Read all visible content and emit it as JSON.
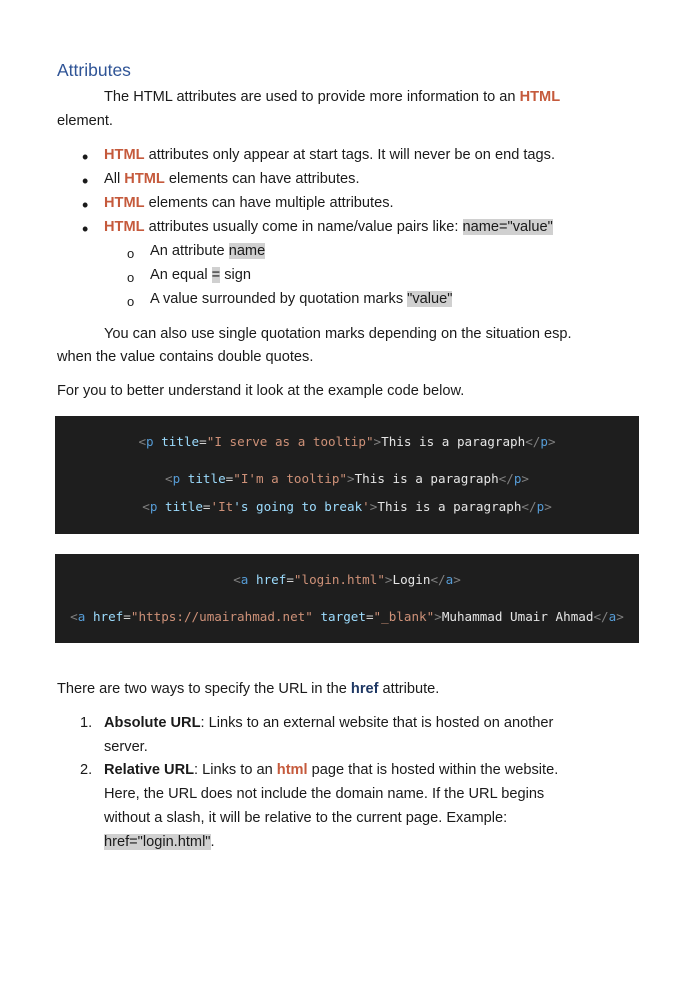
{
  "heading": "Attributes",
  "intro": {
    "a": "The HTML attributes are used to provide more information to an ",
    "hl": "HTML",
    "b": "element."
  },
  "bullets": [
    {
      "hl": "HTML",
      "text": " attributes only appear at start tags. It will never be on end tags."
    },
    {
      "pre": "All ",
      "hl": "HTML",
      "text": " elements can have attributes."
    },
    {
      "hl": "HTML",
      "text": " elements can have multiple attributes."
    },
    {
      "hl": "HTML",
      "text": " attributes usually come in name/value pairs like: ",
      "mark": "name=\"value\""
    }
  ],
  "subbullets": [
    {
      "text": "An attribute ",
      "mark": "name",
      "after": ""
    },
    {
      "text": "An equal ",
      "mark": "=",
      "after": " sign"
    },
    {
      "text": "A value surrounded by quotation marks ",
      "mark": "\"value\"",
      "after": ""
    }
  ],
  "para1": {
    "a": "You can also use single quotation marks depending on the situation esp.",
    "b": "when the value contains double quotes."
  },
  "para2": "For you to better understand it look at the example code below.",
  "code1": [
    [
      [
        "br",
        "<"
      ],
      [
        "tag",
        "p"
      ],
      [
        "txt",
        " "
      ],
      [
        "attr",
        "title"
      ],
      [
        "eq",
        "="
      ],
      [
        "str",
        "\"I serve as a tooltip\""
      ],
      [
        "br",
        ">"
      ],
      [
        "txt",
        "This is a paragraph"
      ],
      [
        "br",
        "</"
      ],
      [
        "tag",
        "p"
      ],
      [
        "br",
        ">"
      ]
    ],
    [
      [
        "br",
        "<"
      ],
      [
        "tag",
        "p"
      ],
      [
        "txt",
        " "
      ],
      [
        "attr",
        "title"
      ],
      [
        "eq",
        "="
      ],
      [
        "str",
        "\"I'm a tooltip\""
      ],
      [
        "br",
        ">"
      ],
      [
        "txt",
        "This is a paragraph"
      ],
      [
        "br",
        "</"
      ],
      [
        "tag",
        "p"
      ],
      [
        "br",
        ">"
      ]
    ],
    [
      [
        "br",
        "<"
      ],
      [
        "tag",
        "p"
      ],
      [
        "txt",
        " "
      ],
      [
        "attr",
        "title"
      ],
      [
        "eq",
        "="
      ],
      [
        "str",
        "'It"
      ],
      [
        "attr",
        "'s going to break"
      ],
      [
        "str",
        "'"
      ],
      [
        "br",
        ">"
      ],
      [
        "txt",
        "This is a paragraph"
      ],
      [
        "br",
        "</"
      ],
      [
        "tag",
        "p"
      ],
      [
        "br",
        ">"
      ]
    ]
  ],
  "code2": [
    [
      [
        "br",
        "<"
      ],
      [
        "tag",
        "a"
      ],
      [
        "txt",
        " "
      ],
      [
        "attr",
        "href"
      ],
      [
        "eq",
        "="
      ],
      [
        "str",
        "\"login.html\""
      ],
      [
        "br",
        ">"
      ],
      [
        "txt",
        "Login"
      ],
      [
        "br",
        "</"
      ],
      [
        "tag",
        "a"
      ],
      [
        "br",
        ">"
      ]
    ],
    [
      [
        "br",
        "<"
      ],
      [
        "tag",
        "a"
      ],
      [
        "txt",
        " "
      ],
      [
        "attr",
        "href"
      ],
      [
        "eq",
        "="
      ],
      [
        "str",
        "\"https://umairahmad.net\""
      ],
      [
        "txt",
        " "
      ],
      [
        "attr",
        "target"
      ],
      [
        "eq",
        "="
      ],
      [
        "str",
        "\"_blank\""
      ],
      [
        "br",
        ">"
      ],
      [
        "txt",
        "Muhammad Umair Ahmad"
      ],
      [
        "br",
        "</"
      ],
      [
        "tag",
        "a"
      ],
      [
        "br",
        ">"
      ]
    ]
  ],
  "para3": {
    "a": "There are two ways to specify the URL in the ",
    "b": "href",
    "c": " attribute."
  },
  "list": [
    {
      "num": "1.",
      "title": "Absolute URL",
      "lines": [
        ": Links to an external website that is hosted on another",
        "server."
      ]
    },
    {
      "num": "2.",
      "title": "Relative URL",
      "pre": ": Links to an ",
      "hl": "html",
      "post": " page that is hosted within the website.",
      "lines": [
        "Here, the URL does not include the domain name. If the URL begins",
        "without a slash, it will be relative to the current page. Example:"
      ],
      "mark": "href=\"login.html\"",
      "end": "."
    }
  ],
  "colors": {
    "heading": "#2f5496",
    "highlight": "#c55a3c",
    "code_bg": "#1e1e1e"
  }
}
